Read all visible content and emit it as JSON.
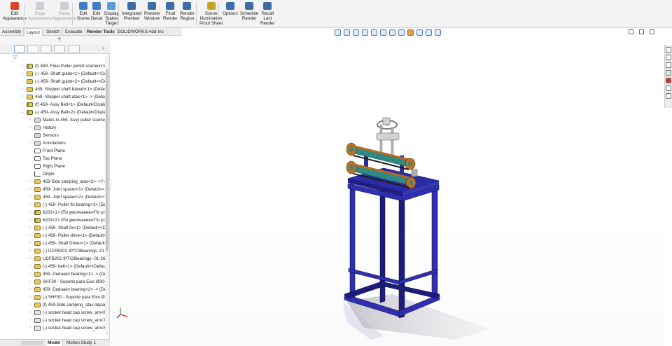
{
  "ribbon": {
    "buttons": [
      {
        "label": "Edit\nAppearance",
        "icon": "appearance-icon",
        "enabled": true
      },
      {
        "label": "Copy\nAppearance",
        "icon": "copy-appearance-icon",
        "enabled": false
      },
      {
        "label": "Paste\nAppearance",
        "icon": "paste-appearance-icon",
        "enabled": false
      },
      {
        "label": "Edit\nScene",
        "icon": "scene-icon",
        "enabled": true
      },
      {
        "label": "Edit\nDecal",
        "icon": "decal-icon",
        "enabled": true
      },
      {
        "label": "Display\nStates\nTarget",
        "icon": "display-states-icon",
        "enabled": true
      },
      {
        "label": "Integrated\nPreview",
        "icon": "integrated-preview-icon",
        "enabled": true
      },
      {
        "label": "Preview\nWindow",
        "icon": "preview-window-icon",
        "enabled": true
      },
      {
        "label": "Final\nRender",
        "icon": "final-render-icon",
        "enabled": true
      },
      {
        "label": "Render\nRegion",
        "icon": "render-region-icon",
        "enabled": true
      },
      {
        "label": "Scene\nIllumination\nProof Sheet",
        "icon": "illumination-icon",
        "enabled": true
      },
      {
        "label": "Options",
        "icon": "options-icon",
        "enabled": true
      },
      {
        "label": "Schedule\nRender",
        "icon": "schedule-render-icon",
        "enabled": true
      },
      {
        "label": "Recall\nLast\nRender",
        "icon": "recall-render-icon",
        "enabled": true
      }
    ]
  },
  "tabs": [
    "Assembly",
    "Layout",
    "Sketch",
    "Evaluate",
    "Render Tools",
    "SOLIDWORKS Add-Ins"
  ],
  "active_tab": "Layout",
  "tree": [
    {
      "label": "(f) 459- Final Puller pencil scamex<1> (D",
      "icon": "asm",
      "indent": 0,
      "arrow": "›"
    },
    {
      "label": "(-) 459- Shaft guide<1> (Default<<Defa",
      "icon": "part",
      "indent": 0,
      "arrow": "›"
    },
    {
      "label": "(-) 459- Shaft guide<2> (Default<<Defa",
      "icon": "part",
      "indent": 0,
      "arrow": "›"
    },
    {
      "label": "459- Stopper shaft bawah<1> (Default<<",
      "icon": "part",
      "indent": 0,
      "arrow": "›"
    },
    {
      "label": "459- Stopper shaft atas<1> -> (Default<",
      "icon": "part",
      "indent": 0,
      "arrow": "›"
    },
    {
      "label": "(f) 459- Assy Belt<1> (Default<Display St",
      "icon": "asm",
      "indent": 0,
      "arrow": "›"
    },
    {
      "label": "(-) 459- Assy Belt<2> (Default<Display St",
      "icon": "asm",
      "indent": 0,
      "arrow": "⌄"
    },
    {
      "label": "Mates in 459- Assy puller scamex",
      "icon": "folder",
      "indent": 1,
      "arrow": "›"
    },
    {
      "label": "History",
      "icon": "folder",
      "indent": 1,
      "arrow": "›"
    },
    {
      "label": "Sensors",
      "icon": "folder",
      "indent": 1,
      "arrow": ""
    },
    {
      "label": "Annotations",
      "icon": "folder",
      "indent": 1,
      "arrow": "›"
    },
    {
      "label": "Front Plane",
      "icon": "plane",
      "indent": 1,
      "arrow": ""
    },
    {
      "label": "Top Plane",
      "icon": "plane",
      "indent": 1,
      "arrow": ""
    },
    {
      "label": "Right Plane",
      "icon": "plane",
      "indent": 1,
      "arrow": ""
    },
    {
      "label": "Origin",
      "icon": "origin",
      "indent": 1,
      "arrow": ""
    },
    {
      "label": "459-Side samping_atas<2> ->? (Defa",
      "icon": "part",
      "indent": 1,
      "arrow": "›"
    },
    {
      "label": "459- Joint spaser<1> (Default<<Defa",
      "icon": "part",
      "indent": 1,
      "arrow": "›"
    },
    {
      "label": "459- Joint spaser<2> (Default<<Defa",
      "icon": "part",
      "indent": 1,
      "arrow": "›"
    },
    {
      "label": "(-) 459- Puller fix bearing<1> (Defau",
      "icon": "part",
      "indent": 1,
      "arrow": "›"
    },
    {
      "label": "6202<1> (По умолчанию<По ул",
      "icon": "asm",
      "indent": 1,
      "arrow": "›"
    },
    {
      "label": "6202<2> (По умолчанию<По ул",
      "icon": "asm",
      "indent": 1,
      "arrow": "›"
    },
    {
      "label": "(-) 459- Shaft fix<1> (Default<<Defa",
      "icon": "part",
      "indent": 1,
      "arrow": "›"
    },
    {
      "label": "(-) 459- Puller drive<1> (Default<<D",
      "icon": "part",
      "indent": 1,
      "arrow": "›"
    },
    {
      "label": "(-) 459- Shaft Driver<1> (Default<<D",
      "icon": "part",
      "indent": 1,
      "arrow": "›"
    },
    {
      "label": "(-) UCFB202-IPTCIBearings--01-26-2",
      "icon": "part",
      "indent": 1,
      "arrow": "›"
    },
    {
      "label": "UCFB202-IPTCIBearings--01-26-202(",
      "icon": "part",
      "indent": 1,
      "arrow": "›"
    },
    {
      "label": "(-) 459- belt<1> (Default<<Default>",
      "icon": "part",
      "indent": 1,
      "arrow": "›"
    },
    {
      "label": "459- Duduakn bearing<1> -> (Defau",
      "icon": "part",
      "indent": 1,
      "arrow": "›"
    },
    {
      "label": "SHF30 - Suporte para Eixo Ø30<1> (",
      "icon": "part",
      "indent": 1,
      "arrow": "›"
    },
    {
      "label": "459- Duduakn bearing<2> -> (Defau",
      "icon": "part",
      "indent": 1,
      "arrow": "›"
    },
    {
      "label": "(-) SHF30 - Suporte para Eixo Ø30<2",
      "icon": "part",
      "indent": 1,
      "arrow": "›"
    },
    {
      "label": "(f) 459-Side samping_atas depan<1>",
      "icon": "part",
      "indent": 1,
      "arrow": "›"
    },
    {
      "label": "(-) socket head cap screw_am<6> (E",
      "icon": "screw",
      "indent": 1,
      "arrow": "›"
    },
    {
      "label": "(-) socket head cap screw_am<7> (E",
      "icon": "screw",
      "indent": 1,
      "arrow": "›"
    },
    {
      "label": "(-) socket head cap screw_am<8> (E",
      "icon": "screw",
      "indent": 1,
      "arrow": "›"
    }
  ],
  "bottom_tabs": [
    "Model",
    "Motion Study 1"
  ],
  "colors": {
    "frame": "#2f2fb0",
    "frame_dark": "#1c1c7a",
    "plate": "#2727a0",
    "roller_body": "#2f8a83",
    "roller_end": "#b86a1f",
    "shaft": "#c9c9c9"
  }
}
